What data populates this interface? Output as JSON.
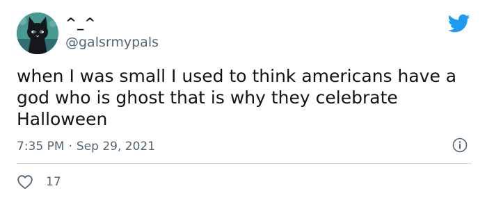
{
  "tweet": {
    "display_name": "^_^",
    "handle": "@galsrmypals",
    "text_lines": [
      "when I was small I used to think americans have a",
      "god who is ghost that is why they celebrate",
      "Halloween"
    ],
    "time": "7:35 PM",
    "separator": "·",
    "date": "Sep 29, 2021",
    "like_count": "17"
  },
  "icons": {
    "brand": "twitter-bird-icon",
    "avatar": "black-cat-avatar",
    "info": "info-icon",
    "like": "heart-icon"
  },
  "colors": {
    "brand": "#1d9bf0",
    "text": "#0f1419",
    "secondary": "#536471",
    "divider": "#cfd9de"
  }
}
